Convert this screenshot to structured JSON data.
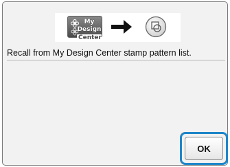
{
  "dialog": {
    "icons": {
      "source": "my-design-center-icon",
      "direction": "right-arrow-icon",
      "target": "stamp-pattern-icon"
    },
    "source_icon_label_line1": "My Design",
    "source_icon_label_line2": "Center",
    "message": "Recall from My Design Center stamp pattern list.",
    "ok_label": "OK"
  },
  "colors": {
    "highlight": "#1f86c8",
    "dialog_background": "#f2f2f2"
  }
}
